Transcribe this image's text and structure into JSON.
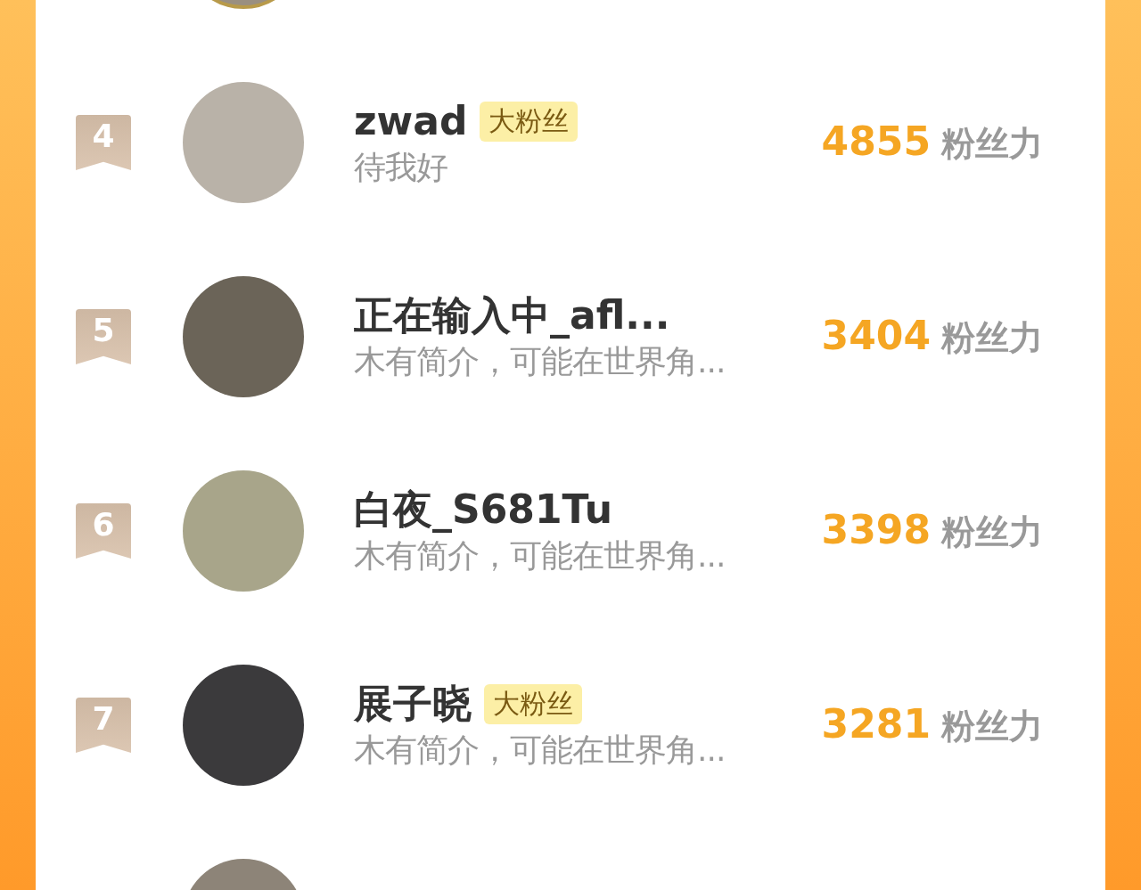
{
  "fans": [
    {
      "rank": "4",
      "name": "zwad",
      "tag": "大粉丝",
      "bio": "待我好",
      "score": "4855",
      "unit": "粉丝力"
    },
    {
      "rank": "5",
      "name": "正在输入中_afl...",
      "bio": "木有简介，可能在世界角...",
      "score": "3404",
      "unit": "粉丝力"
    },
    {
      "rank": "6",
      "name": "白夜_S681Tu",
      "bio": "木有简介，可能在世界角...",
      "score": "3398",
      "unit": "粉丝力"
    },
    {
      "rank": "7",
      "name": "展子晓",
      "tag": "大粉丝",
      "bio": "木有简介，可能在世界角...",
      "score": "3281",
      "unit": "粉丝力"
    }
  ]
}
